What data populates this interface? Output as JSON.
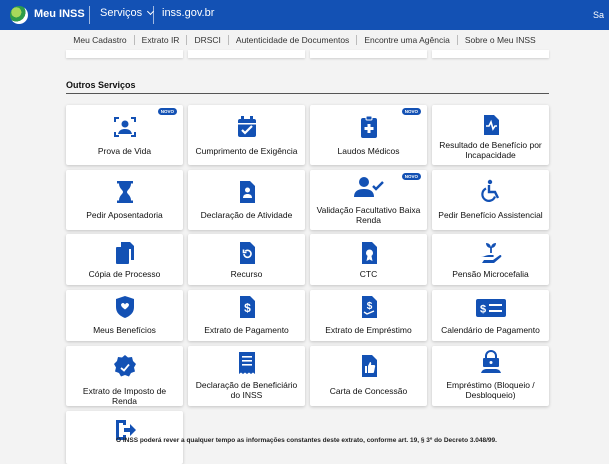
{
  "header": {
    "brand": "Meu INSS",
    "services_menu": "Serviços",
    "domain": "inss.gov.br",
    "right_text": "Sa"
  },
  "subnav": [
    "Meu Cadastro",
    "Extrato IR",
    "DRSCI",
    "Autenticidade de Documentos",
    "Encontre uma Agência",
    "Sobre o Meu INSS"
  ],
  "section": {
    "title": "Outros Serviços"
  },
  "badge_text": "NOVO",
  "cards": [
    {
      "label": "Prova de Vida",
      "icon": "person-scan-icon",
      "badge": true
    },
    {
      "label": "Cumprimento de Exigência",
      "icon": "calendar-check-icon",
      "badge": false
    },
    {
      "label": "Laudos Médicos",
      "icon": "medical-clipboard-icon",
      "badge": true
    },
    {
      "label": "Resultado de Benefício por Incapacidade",
      "icon": "health-report-icon",
      "badge": false
    },
    {
      "label": "Pedir Aposentadoria",
      "icon": "hourglass-icon",
      "badge": false
    },
    {
      "label": "Declaração de Atividade",
      "icon": "id-document-icon",
      "badge": false
    },
    {
      "label": "Validação Facultativo Baixa Renda",
      "icon": "user-check-icon",
      "badge": true
    },
    {
      "label": "Pedir Benefício Assistencial",
      "icon": "wheelchair-icon",
      "badge": false
    },
    {
      "label": "Cópia de Processo",
      "icon": "copy-documents-icon",
      "badge": false
    },
    {
      "label": "Recurso",
      "icon": "document-refresh-icon",
      "badge": false
    },
    {
      "label": "CTC",
      "icon": "document-stamp-icon",
      "badge": false
    },
    {
      "label": "Pensão Microcefalia",
      "icon": "hand-plant-icon",
      "badge": false
    },
    {
      "label": "Meus Benefícios",
      "icon": "shield-hand-icon",
      "badge": false
    },
    {
      "label": "Extrato de Pagamento",
      "icon": "document-dollar-icon",
      "badge": false
    },
    {
      "label": "Extrato de Empréstimo",
      "icon": "loan-document-icon",
      "badge": false
    },
    {
      "label": "Calendário de Pagamento",
      "icon": "money-card-icon",
      "badge": false
    },
    {
      "label": "Extrato de Imposto de Renda",
      "icon": "tax-badge-icon",
      "badge": false
    },
    {
      "label": "Declaração de Beneficiário do INSS",
      "icon": "receipt-icon",
      "badge": false
    },
    {
      "label": "Carta de Concessão",
      "icon": "document-thumb-icon",
      "badge": false
    },
    {
      "label": "Empréstimo (Bloqueio / Desbloqueio)",
      "icon": "lock-user-icon",
      "badge": false
    },
    {
      "label": "",
      "icon": "exit-icon",
      "badge": false
    }
  ],
  "footer_note": "O INSS poderá rever a qualquer tempo as informações constantes deste extrato, conforme art. 19, § 3º do Decreto 3.048/99.",
  "colors": {
    "primary": "#1351b4",
    "background": "#f3f3f3",
    "card": "#ffffff"
  }
}
